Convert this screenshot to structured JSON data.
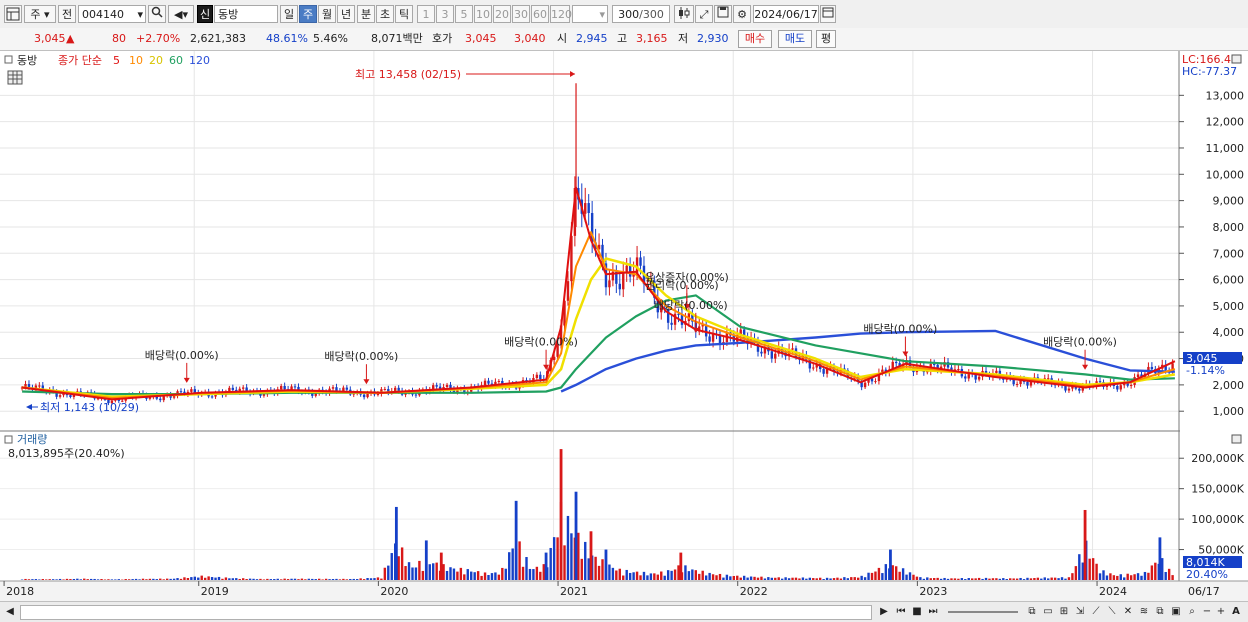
{
  "toolbar": {
    "type_label": "주",
    "prev_label": "전",
    "code": "004140",
    "stock_name": "동방",
    "stock_badge": "신",
    "periods": [
      "일",
      "주",
      "월",
      "년",
      "분",
      "초",
      "틱"
    ],
    "selected_period": "주",
    "intervals": [
      "1",
      "3",
      "5",
      "10",
      "20",
      "30",
      "60",
      "120"
    ],
    "count": "300",
    "count_total": "/300",
    "date": "2024/06/17"
  },
  "quote": {
    "price": "3,045",
    "arrow": "▲",
    "change": "80",
    "change_pct": "+2.70%",
    "volume": "2,621,383",
    "vol_ratio": "48.61%",
    "turnover": "5.46%",
    "amount": "8,071백만",
    "hoga_label": "호가",
    "ask": "3,045",
    "bid": "3,040",
    "open_label": "시",
    "open": "2,945",
    "high_label": "고",
    "high": "3,165",
    "low_label": "저",
    "low": "2,930",
    "buy_label": "매수",
    "sell_label": "매도",
    "eval_label": "평"
  },
  "price_panel": {
    "name": "동방",
    "ma_label": "종가 단순",
    "ma_periods": [
      "5",
      "10",
      "20",
      "60",
      "120"
    ],
    "ma_colors": [
      "#e01010",
      "#ff8a00",
      "#f0e000",
      "#20a060",
      "#2a4fd8"
    ],
    "lc_label": "LC:166.40",
    "hc_label": "HC:-77.37",
    "last_price_box": "3,045",
    "last_pct": "-1.14%",
    "high_annotation": "최고 13,458 (02/15)",
    "low_annotation": "최저 1,143 (10/29)",
    "events": [
      {
        "label": "배당락(0.00%)",
        "date": "2018-12"
      },
      {
        "label": "배당락(0.00%)",
        "date": "2019-12"
      },
      {
        "label": "배당락(0.00%)",
        "date": "2020-12"
      },
      {
        "label": "유상증자(0.00%)",
        "date": "2021-09"
      },
      {
        "label": "권리락(0.00%)",
        "date": "2021-09"
      },
      {
        "label": "배당락(0.00%)",
        "date": "2021-10"
      },
      {
        "label": "배당락(0.00%)",
        "date": "2022-12"
      },
      {
        "label": "배당락(0.00%)",
        "date": "2023-12"
      }
    ]
  },
  "volume_panel": {
    "label": "거래량",
    "current": "8,013,895주(20.40%)",
    "last_vol_box": "8,014K",
    "last_vol_pct": "20.40%"
  },
  "xaxis": {
    "labels": [
      "2018",
      "2019",
      "2020",
      "2021",
      "2022",
      "2023",
      "2024",
      "06/17"
    ]
  },
  "chart_data": {
    "type": "line",
    "title": "",
    "price_axis": {
      "ticks": [
        1000,
        2000,
        3000,
        4000,
        5000,
        6000,
        7000,
        8000,
        9000,
        10000,
        11000,
        12000,
        13000
      ],
      "tick_labels": [
        "1,000",
        "2,000",
        "3,000",
        "4,000",
        "5,000",
        "6,000",
        "7,000",
        "8,000",
        "9,000",
        "10,000",
        "11,000",
        "12,000",
        "13,000"
      ],
      "ylim": [
        400,
        14000
      ]
    },
    "volume_axis": {
      "ticks": [
        50000,
        100000,
        150000,
        200000
      ],
      "tick_labels": [
        "50,000K",
        "100,000K",
        "150,000K",
        "200,000K"
      ],
      "ylim": [
        0,
        225000
      ]
    },
    "series": [
      {
        "name": "5",
        "x": [
          "2018-01",
          "2018-07",
          "2019-01",
          "2019-07",
          "2020-01",
          "2020-07",
          "2020-12",
          "2021-01",
          "2021-02",
          "2021-03",
          "2021-04",
          "2021-06",
          "2021-08",
          "2021-10",
          "2022-01",
          "2022-06",
          "2022-09",
          "2022-12",
          "2023-06",
          "2023-12",
          "2024-03",
          "2024-06"
        ],
        "values": [
          1900,
          1450,
          1700,
          1800,
          1700,
          1900,
          2200,
          4200,
          9500,
          7500,
          6200,
          6300,
          4800,
          4100,
          3700,
          2800,
          2100,
          2800,
          2300,
          1900,
          2100,
          2900
        ]
      },
      {
        "name": "10",
        "x": [
          "2018-01",
          "2018-07",
          "2019-01",
          "2019-07",
          "2020-01",
          "2020-07",
          "2020-12",
          "2021-01",
          "2021-02",
          "2021-03",
          "2021-04",
          "2021-06",
          "2021-08",
          "2021-10",
          "2022-01",
          "2022-06",
          "2022-09",
          "2022-12",
          "2023-06",
          "2023-12",
          "2024-03",
          "2024-06"
        ],
        "values": [
          1900,
          1500,
          1680,
          1780,
          1690,
          1880,
          2100,
          3200,
          6500,
          7800,
          6400,
          6200,
          5000,
          4400,
          3800,
          2900,
          2200,
          2700,
          2350,
          1950,
          2100,
          2600
        ]
      },
      {
        "name": "20",
        "x": [
          "2018-01",
          "2018-07",
          "2019-01",
          "2019-07",
          "2020-01",
          "2020-07",
          "2020-12",
          "2021-01",
          "2021-02",
          "2021-03",
          "2021-04",
          "2021-06",
          "2021-08",
          "2021-10",
          "2022-01",
          "2022-06",
          "2022-09",
          "2022-12",
          "2023-06",
          "2023-12",
          "2024-03",
          "2024-06"
        ],
        "values": [
          1900,
          1550,
          1650,
          1750,
          1700,
          1850,
          2000,
          2600,
          4500,
          6000,
          6800,
          6500,
          5400,
          4600,
          3900,
          3000,
          2300,
          2600,
          2400,
          2000,
          2100,
          2400
        ]
      },
      {
        "name": "60",
        "x": [
          "2018-01",
          "2018-07",
          "2019-01",
          "2019-07",
          "2020-01",
          "2020-07",
          "2020-12",
          "2021-01",
          "2021-02",
          "2021-03",
          "2021-04",
          "2021-06",
          "2021-08",
          "2021-10",
          "2022-01",
          "2022-06",
          "2022-09",
          "2022-12",
          "2023-06",
          "2023-12",
          "2024-03",
          "2024-06"
        ],
        "values": [
          1750,
          1650,
          1650,
          1700,
          1700,
          1700,
          1750,
          1900,
          2600,
          3200,
          3800,
          4600,
          5200,
          5400,
          4200,
          3500,
          3200,
          2900,
          2700,
          2400,
          2200,
          2250
        ]
      },
      {
        "name": "120",
        "x": [
          "2018-01",
          "2018-07",
          "2019-01",
          "2019-07",
          "2020-01",
          "2020-07",
          "2020-12",
          "2021-01",
          "2021-02",
          "2021-03",
          "2021-04",
          "2021-06",
          "2021-08",
          "2021-10",
          "2022-01",
          "2022-06",
          "2022-09",
          "2022-12",
          "2023-06",
          "2023-12",
          "2024-03",
          "2024-06"
        ],
        "values": [
          null,
          null,
          null,
          null,
          null,
          null,
          null,
          1750,
          2000,
          2300,
          2600,
          3000,
          3300,
          3500,
          3600,
          3800,
          3950,
          4000,
          4050,
          3000,
          2550,
          2500
        ]
      }
    ],
    "high": {
      "x": "2021-02",
      "value": 13458
    },
    "low": {
      "x": "2018-10",
      "value": 1143
    },
    "volume": {
      "x": [
        "2018-01",
        "2018-03",
        "2018-05",
        "2018-07",
        "2018-09",
        "2018-11",
        "2019-01",
        "2019-03",
        "2019-05",
        "2019-07",
        "2019-09",
        "2019-11",
        "2020-01",
        "2020-02",
        "2020-03",
        "2020-04",
        "2020-05",
        "2020-06",
        "2020-07",
        "2020-08",
        "2020-09",
        "2020-10",
        "2020-11",
        "2020-12",
        "2021-01",
        "2021-02",
        "2021-03",
        "2021-04",
        "2021-05",
        "2021-06",
        "2021-07",
        "2021-08",
        "2021-09",
        "2021-10",
        "2021-11",
        "2021-12",
        "2022-01",
        "2022-03",
        "2022-05",
        "2022-07",
        "2022-09",
        "2022-11",
        "2023-01",
        "2023-03",
        "2023-05",
        "2023-07",
        "2023-09",
        "2023-11",
        "2023-12",
        "2024-01",
        "2024-02",
        "2024-03",
        "2024-04",
        "2024-05",
        "2024-06"
      ],
      "values": [
        3000,
        2500,
        4000,
        2000,
        3500,
        4000,
        12000,
        6000,
        3000,
        4000,
        3500,
        3000,
        8000,
        120000,
        40000,
        65000,
        45000,
        35000,
        30000,
        20000,
        25000,
        130000,
        35000,
        45000,
        215000,
        145000,
        80000,
        50000,
        30000,
        25000,
        20000,
        25000,
        45000,
        30000,
        20000,
        15000,
        12000,
        8000,
        7000,
        6000,
        10000,
        50000,
        8000,
        5000,
        6000,
        5000,
        7000,
        8000,
        115000,
        30000,
        15000,
        18000,
        22000,
        70000,
        8014
      ]
    }
  }
}
